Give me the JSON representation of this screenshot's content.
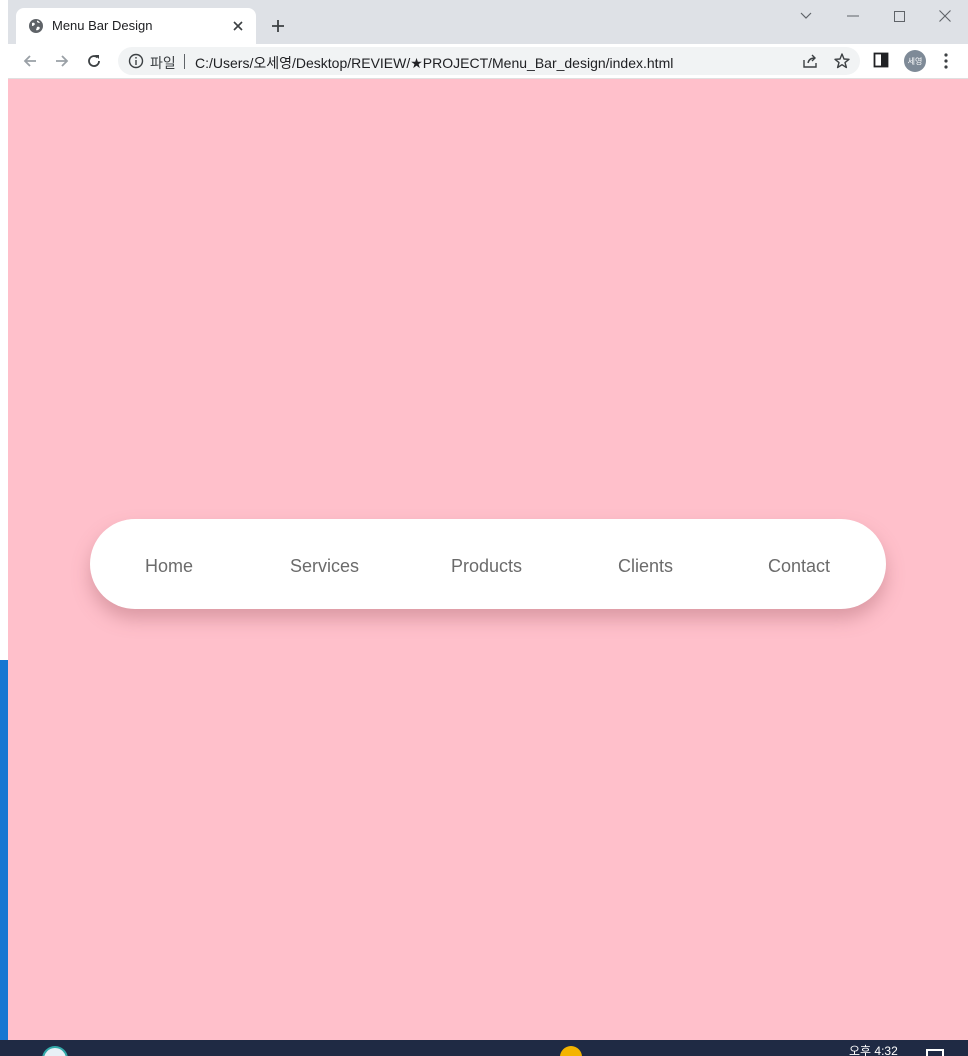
{
  "browser": {
    "tab_title": "Menu Bar Design",
    "scheme_label": "파일",
    "url": "C:/Users/오세영/Desktop/REVIEW/★PROJECT/Menu_Bar_design/index.html",
    "profile_initials": "세영"
  },
  "page": {
    "background_color": "#ffc0cb",
    "menu": [
      {
        "label": "Home"
      },
      {
        "label": "Services"
      },
      {
        "label": "Products"
      },
      {
        "label": "Clients"
      },
      {
        "label": "Contact"
      }
    ]
  },
  "taskbar": {
    "clock": "오후 4:32"
  }
}
